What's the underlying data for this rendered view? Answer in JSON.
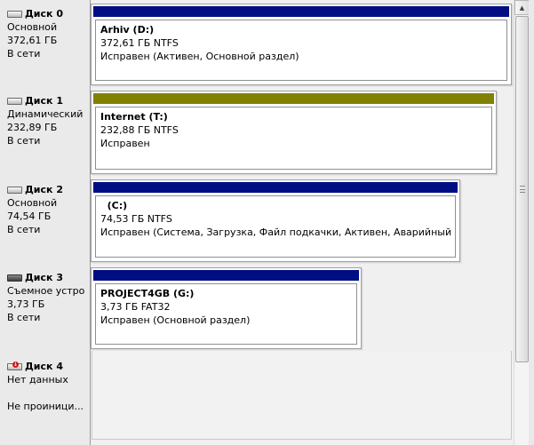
{
  "colors": {
    "primary_bar": "#000e84",
    "dynamic_bar": "#818100"
  },
  "disks": [
    {
      "name": "Диск 0",
      "type": "Основной",
      "size": "372,61 ГБ",
      "status": "В сети",
      "icon": "disk-icon",
      "partition": {
        "label": "Arhiv  (D:)",
        "size_fs": "372,61 ГБ NTFS",
        "health": "Исправен (Активен, Основной раздел)",
        "bar": "primary"
      }
    },
    {
      "name": "Диск 1",
      "type": "Динамический",
      "size": "232,89 ГБ",
      "status": "В сети",
      "icon": "disk-icon",
      "partition": {
        "label": "Internet  (T:)",
        "size_fs": "232,88 ГБ NTFS",
        "health": "Исправен",
        "bar": "dynamic"
      }
    },
    {
      "name": "Диск 2",
      "type": "Основной",
      "size": "74,54 ГБ",
      "status": "В сети",
      "icon": "disk-icon",
      "partition": {
        "label": "  (C:)",
        "size_fs": "74,53 ГБ NTFS",
        "health": "Исправен (Система, Загрузка, Файл подкачки, Активен, Аварийный дам",
        "bar": "primary"
      }
    },
    {
      "name": "Диск 3",
      "type": "Съемное устро",
      "size": "3,73 ГБ",
      "status": "В сети",
      "icon": "removable-disk-icon",
      "partition": {
        "label": "PROJECT4GB  (G:)",
        "size_fs": "3,73 ГБ FAT32",
        "health": "Исправен (Основной раздел)",
        "bar": "primary"
      }
    },
    {
      "name": "Диск 4",
      "type": "Нет данных",
      "size": "",
      "status": "Не проиници...",
      "icon": "uninitialized-disk-icon"
    }
  ]
}
